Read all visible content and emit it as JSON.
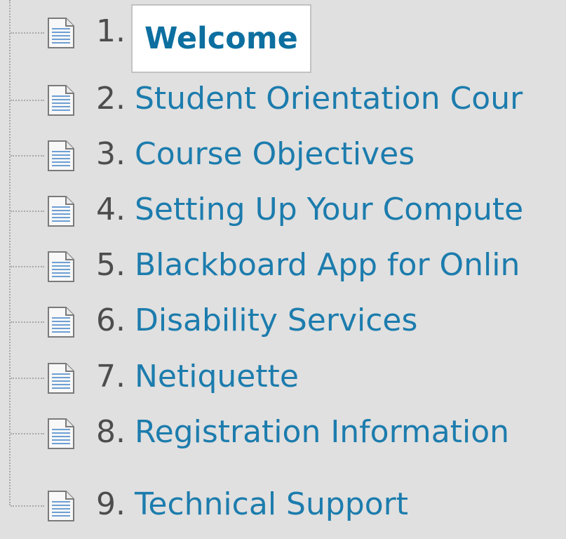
{
  "outline": {
    "items": [
      {
        "number": "1.",
        "label": "Welcome",
        "selected": true
      },
      {
        "number": "2.",
        "label": "Student Orientation Cour"
      },
      {
        "number": "3.",
        "label": "Course Objectives"
      },
      {
        "number": "4.",
        "label": "Setting Up Your Compute"
      },
      {
        "number": "5.",
        "label": "Blackboard App for Onlin"
      },
      {
        "number": "6.",
        "label": "Disability Services"
      },
      {
        "number": "7.",
        "label": "Netiquette"
      },
      {
        "number": "8.",
        "label": "Registration Information"
      },
      {
        "number": "9.",
        "label": "Technical Support"
      }
    ]
  },
  "icon": "document-page-icon",
  "colors": {
    "background": "#e0e0e0",
    "link": "#1c7cad",
    "selected_link": "#0d6fa0",
    "number": "#4d4d4d",
    "connector": "#a9a9a9"
  }
}
